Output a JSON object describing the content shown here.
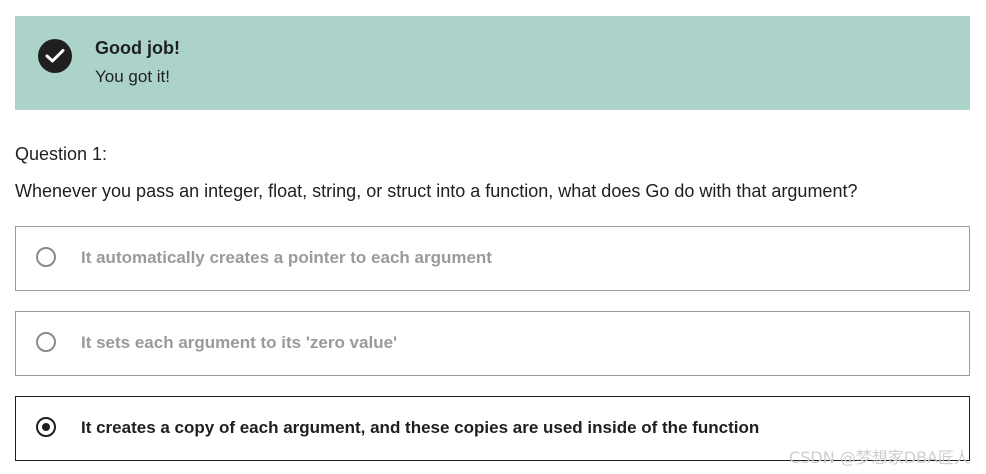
{
  "feedback": {
    "title": "Good job!",
    "subtitle": "You got it!",
    "icon": "check-circle-icon",
    "background_color": "#acd3ca"
  },
  "question": {
    "label": "Question 1:",
    "text": "Whenever you pass an integer, float, string, or struct into a function, what does Go do with that argument?",
    "options": [
      {
        "label": "It automatically creates a pointer to each argument",
        "selected": false
      },
      {
        "label": "It sets each argument to its 'zero value'",
        "selected": false
      },
      {
        "label": "It creates a copy of each argument, and these copies are used inside of the function",
        "selected": true
      }
    ]
  },
  "watermark": "CSDN @梦想家DBA匠人"
}
